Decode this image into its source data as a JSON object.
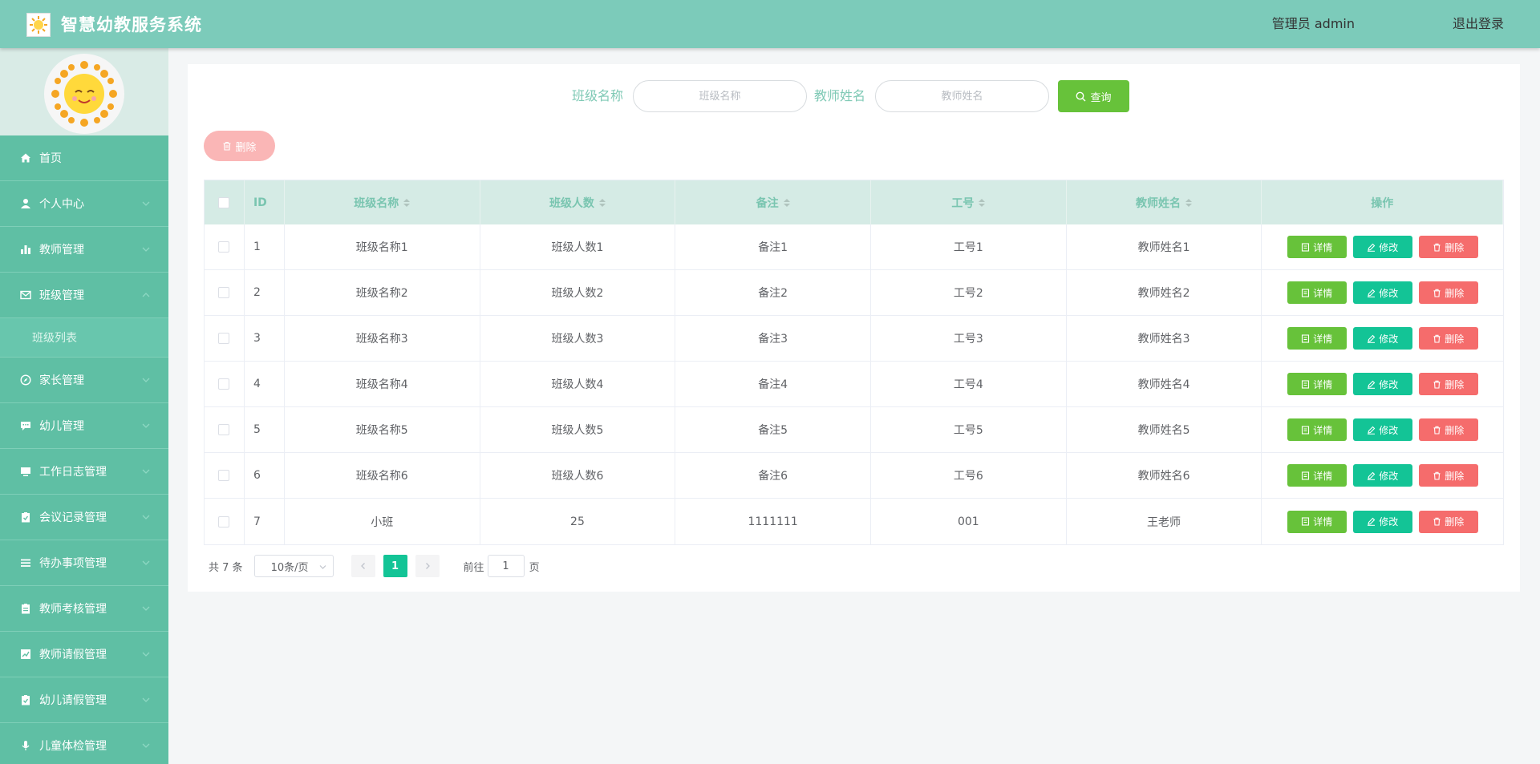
{
  "header": {
    "title": "智慧幼教服务系统",
    "user": "管理员 admin",
    "logout": "退出登录"
  },
  "sidebar": {
    "items": [
      {
        "label": "首页",
        "icon": "home-icon"
      },
      {
        "label": "个人中心",
        "icon": "user-icon"
      },
      {
        "label": "教师管理",
        "icon": "bar-chart-icon"
      },
      {
        "label": "班级管理",
        "icon": "mail-icon",
        "expanded": true
      },
      {
        "label": "家长管理",
        "icon": "compass-icon"
      },
      {
        "label": "幼儿管理",
        "icon": "chat-icon"
      },
      {
        "label": "工作日志管理",
        "icon": "monitor-icon"
      },
      {
        "label": "会议记录管理",
        "icon": "clipboard-check-icon"
      },
      {
        "label": "待办事项管理",
        "icon": "list-icon"
      },
      {
        "label": "教师考核管理",
        "icon": "clipboard-icon"
      },
      {
        "label": "教师请假管理",
        "icon": "trend-icon"
      },
      {
        "label": "幼儿请假管理",
        "icon": "clipboard-check-icon"
      },
      {
        "label": "儿童体检管理",
        "icon": "microphone-icon"
      }
    ],
    "subitem": "班级列表"
  },
  "search": {
    "class_label": "班级名称",
    "class_placeholder": "班级名称",
    "teacher_label": "教师姓名",
    "teacher_placeholder": "教师姓名",
    "query": "查询"
  },
  "bulk_delete": "删除",
  "table": {
    "headers": {
      "id": "ID",
      "class_name": "班级名称",
      "class_size": "班级人数",
      "remark": "备注",
      "emp_no": "工号",
      "teacher": "教师姓名",
      "ops": "操作"
    },
    "rows": [
      {
        "id": "1",
        "class_name": "班级名称1",
        "class_size": "班级人数1",
        "remark": "备注1",
        "emp_no": "工号1",
        "teacher": "教师姓名1"
      },
      {
        "id": "2",
        "class_name": "班级名称2",
        "class_size": "班级人数2",
        "remark": "备注2",
        "emp_no": "工号2",
        "teacher": "教师姓名2"
      },
      {
        "id": "3",
        "class_name": "班级名称3",
        "class_size": "班级人数3",
        "remark": "备注3",
        "emp_no": "工号3",
        "teacher": "教师姓名3"
      },
      {
        "id": "4",
        "class_name": "班级名称4",
        "class_size": "班级人数4",
        "remark": "备注4",
        "emp_no": "工号4",
        "teacher": "教师姓名4"
      },
      {
        "id": "5",
        "class_name": "班级名称5",
        "class_size": "班级人数5",
        "remark": "备注5",
        "emp_no": "工号5",
        "teacher": "教师姓名5"
      },
      {
        "id": "6",
        "class_name": "班级名称6",
        "class_size": "班级人数6",
        "remark": "备注6",
        "emp_no": "工号6",
        "teacher": "教师姓名6"
      },
      {
        "id": "7",
        "class_name": "小班",
        "class_size": "25",
        "remark": "1111111",
        "emp_no": "001",
        "teacher": "王老师"
      }
    ],
    "actions": {
      "detail": "详情",
      "edit": "修改",
      "delete": "删除"
    }
  },
  "pagination": {
    "total": "共 7 条",
    "page_size": "10条/页",
    "current_page": "1",
    "goto_label": "前往",
    "goto_value": "1",
    "page_unit": "页"
  },
  "colors": {
    "header": "#7ccbba",
    "sidebar": "#5fbfa4",
    "primary": "#13c496",
    "success": "#67c23a",
    "danger": "#f56c6c"
  }
}
